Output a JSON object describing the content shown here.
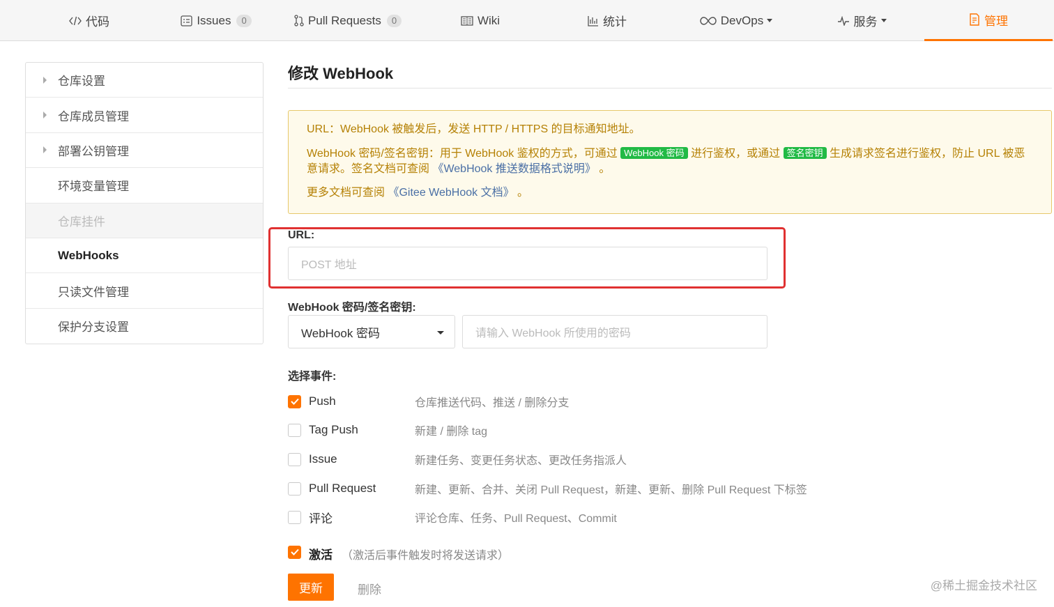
{
  "colors": {
    "accent": "#fe7300",
    "tag_green": "#21ba45",
    "notice_bg": "#fefaeb",
    "frame_red": "#e03131"
  },
  "nav": {
    "tabs": [
      {
        "label": "代码",
        "icon": "code-icon"
      },
      {
        "label": "Issues",
        "icon": "issues-icon",
        "count": "0"
      },
      {
        "label": "Pull Requests",
        "icon": "pull-request-icon",
        "count": "0"
      },
      {
        "label": "Wiki",
        "icon": "wiki-icon"
      },
      {
        "label": "统计",
        "icon": "chart-icon"
      },
      {
        "label": "DevOps",
        "icon": "infinity-icon"
      },
      {
        "label": "服务",
        "icon": "pulse-icon"
      },
      {
        "label": "管理",
        "icon": "manage-icon"
      }
    ]
  },
  "sidebar": {
    "items": [
      {
        "label": "仓库设置"
      },
      {
        "label": "仓库成员管理"
      },
      {
        "label": "部署公钥管理"
      },
      {
        "label": "环境变量管理"
      },
      {
        "label": "仓库挂件"
      },
      {
        "label": "WebHooks"
      },
      {
        "label": "只读文件管理"
      },
      {
        "label": "保护分支设置"
      }
    ]
  },
  "main": {
    "title": "修改 WebHook",
    "notice": {
      "line1": "URL：WebHook 被触发后，发送 HTTP / HTTPS 的目标通知地址。",
      "line2_a": "WebHook 密码/签名密钥：用于 WebHook 鉴权的方式，可通过",
      "tag1": "WebHook 密码",
      "line2_b": "进行鉴权，或通过",
      "tag2": "签名密钥",
      "line2_c": "生成请求签名进行鉴权，防止 URL 被恶意请求。签名文档可查阅",
      "link1": "《WebHook 推送数据格式说明》",
      "line2_d": "。",
      "line3_a": "更多文档可查阅",
      "link2": "《Gitee WebHook 文档》",
      "line3_b": "。"
    },
    "url": {
      "label": "URL:",
      "placeholder": "POST 地址",
      "value": ""
    },
    "secret": {
      "label": "WebHook 密码/签名密钥:",
      "select_value": "WebHook 密码",
      "placeholder": "请输入 WebHook 所使用的密码"
    },
    "events": {
      "label": "选择事件:",
      "items": [
        {
          "name": "Push",
          "desc": "仓库推送代码、推送 / 删除分支",
          "checked": true
        },
        {
          "name": "Tag Push",
          "desc": "新建 / 删除 tag",
          "checked": false
        },
        {
          "name": "Issue",
          "desc": "新建任务、变更任务状态、更改任务指派人",
          "checked": false
        },
        {
          "name": "Pull Request",
          "desc": "新建、更新、合并、关闭 Pull Request，新建、更新、删除 Pull Request 下标签",
          "checked": false
        },
        {
          "name": "评论",
          "desc": "评论仓库、任务、Pull Request、Commit",
          "checked": false
        }
      ]
    },
    "activate": {
      "label": "激活",
      "desc": "（激活后事件触发时将发送请求）",
      "checked": true
    },
    "update_label": "更新",
    "delete_label": "删除"
  },
  "watermark": "@稀土掘金技术社区"
}
